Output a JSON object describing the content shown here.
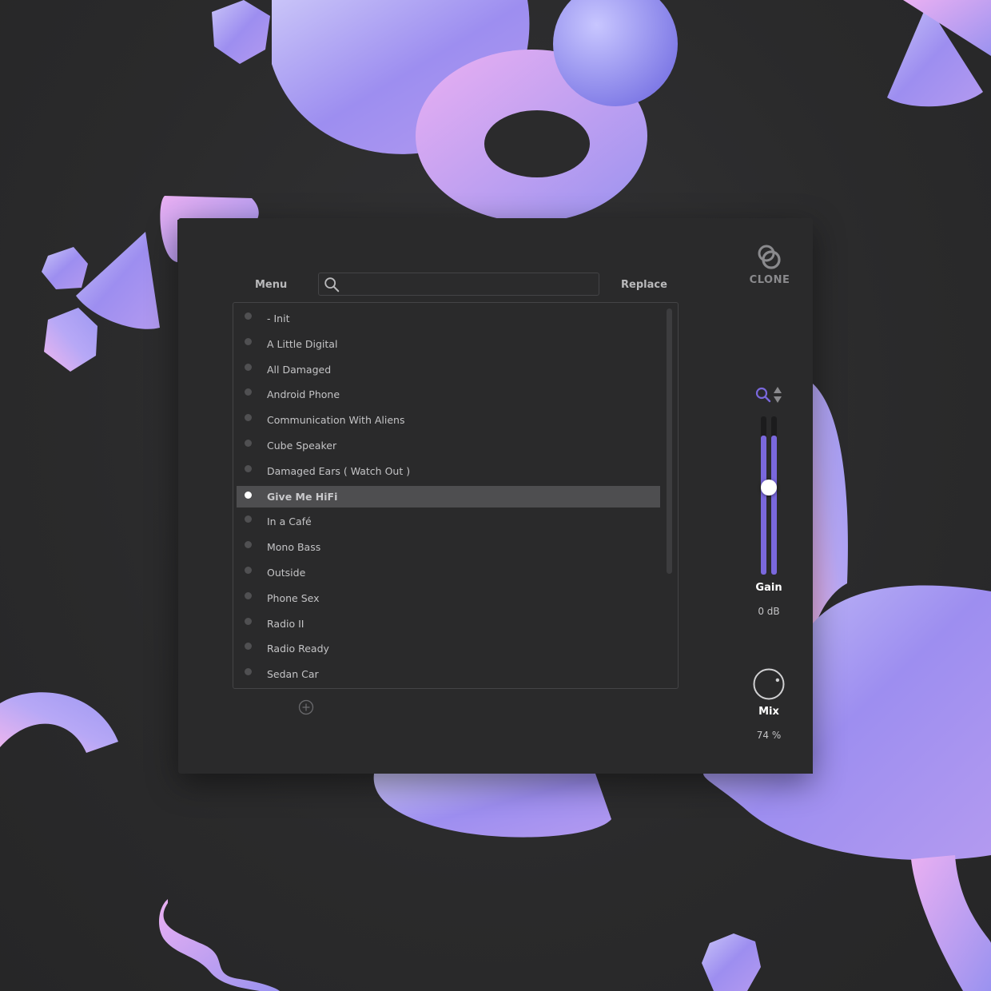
{
  "colors": {
    "accent": "#7a68dd",
    "panel": "#2a2a2b",
    "background": "#2b2b2c",
    "shape_light": "#b7a6f5",
    "shape_pink": "#e7a7f0"
  },
  "toolbar": {
    "menu_label": "Menu",
    "search_placeholder": "",
    "search_icon": "search-icon",
    "replace_label": "Replace"
  },
  "presets": {
    "items": [
      {
        "name": "- Init",
        "selected": false
      },
      {
        "name": "A Little Digital",
        "selected": false
      },
      {
        "name": "All Damaged",
        "selected": false
      },
      {
        "name": "Android Phone",
        "selected": false
      },
      {
        "name": "Communication With Aliens",
        "selected": false
      },
      {
        "name": "Cube Speaker",
        "selected": false
      },
      {
        "name": "Damaged Ears ( Watch Out )",
        "selected": false
      },
      {
        "name": "Give Me HiFi",
        "selected": true
      },
      {
        "name": "In a Café",
        "selected": false
      },
      {
        "name": "Mono Bass",
        "selected": false
      },
      {
        "name": "Outside",
        "selected": false
      },
      {
        "name": "Phone Sex",
        "selected": false
      },
      {
        "name": "Radio II",
        "selected": false
      },
      {
        "name": "Radio Ready",
        "selected": false
      },
      {
        "name": "Sedan Car",
        "selected": false
      }
    ],
    "add_icon": "plus-circle-icon"
  },
  "brand": {
    "logo_icon": "clone-logo-icon",
    "name": "CLONE"
  },
  "gain": {
    "label": "Gain",
    "value": "0 dB",
    "level": 0.88,
    "thumb_fraction": 0.5
  },
  "mix": {
    "label": "Mix",
    "value": "74 %",
    "fraction": 0.74
  }
}
